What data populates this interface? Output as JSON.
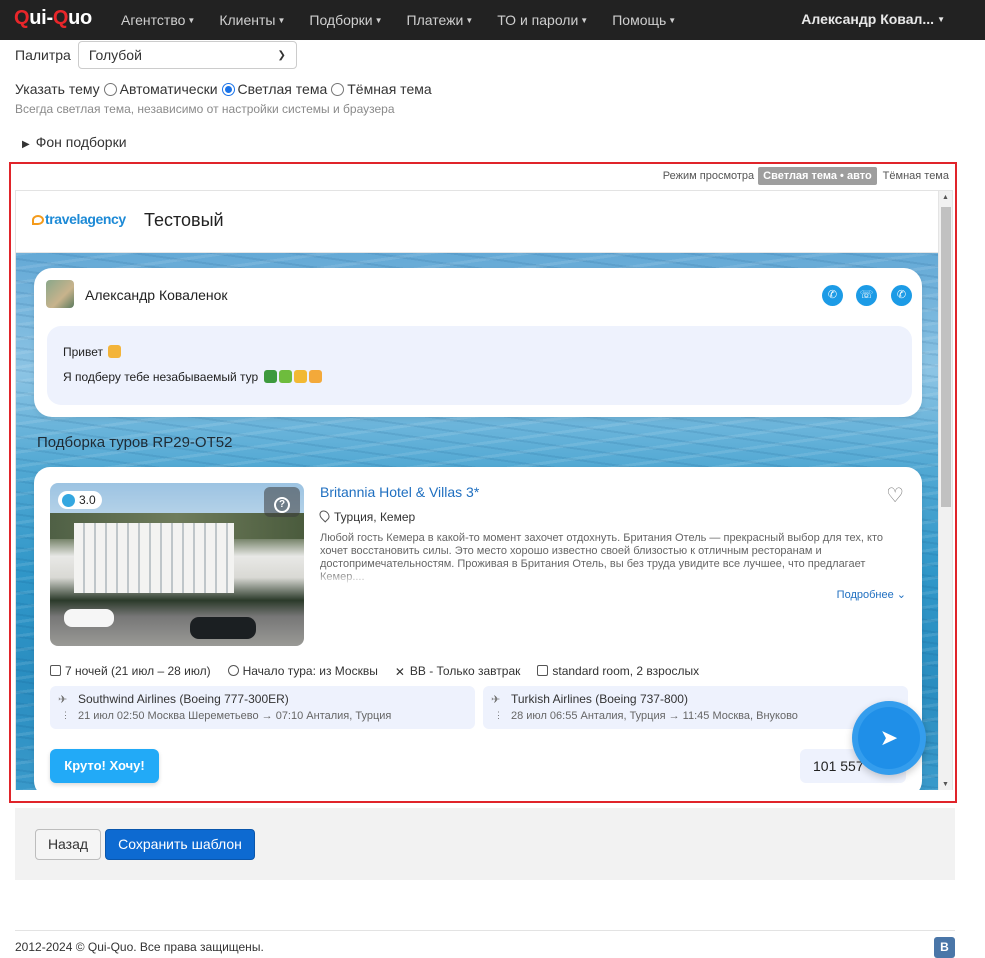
{
  "navbar": {
    "brand_q": "Q",
    "brand_mid": "ui-",
    "brand_q2": "Q",
    "brand_end": "uo",
    "items": [
      {
        "label": "Агентство"
      },
      {
        "label": "Клиенты"
      },
      {
        "label": "Подборки"
      },
      {
        "label": "Платежи"
      },
      {
        "label": "ТО и пароли"
      },
      {
        "label": "Помощь"
      }
    ],
    "user": "Александр Ковал..."
  },
  "settings": {
    "palette_label": "Палитра",
    "palette_value": "Голубой",
    "theme_label": "Указать тему",
    "theme_options": [
      "Автоматически",
      "Светлая тема",
      "Тёмная тема"
    ],
    "theme_selected": "Светлая тема",
    "theme_hint": "Всегда светлая тема, независимо от настройки системы и браузера",
    "background_toggle": "Фон подборки"
  },
  "preview": {
    "mode_label": "Режим просмотра",
    "mode_active": "Светлая тема • авто",
    "mode_other": "Тёмная тема",
    "agency_logo": "travelagency",
    "agency_title": "Тестовый",
    "manager": {
      "name": "Александр Коваленок",
      "greeting": "Привет",
      "message": "Я подберу тебе незабываемый тур"
    },
    "selection_title": "Подборка туров RP29-OT52",
    "hotel": {
      "rating": "3.0",
      "name": "Britannia Hotel & Villas 3*",
      "location": "Турция, Кемер",
      "description": "Любой гость Кемера в какой-то момент захочет отдохнуть. Британия Отель — прекрасный выбор для тех, кто хочет восстановить силы. Это место хорошо известно своей близостью к отличным ресторанам и достопримечательностям. Проживая в Британия Отель, вы без труда увидите все лучшее, что предлагает Кемер....",
      "more": "Подробнее",
      "nights": "7 ночей (21 июл – 28 июл)",
      "start": "Начало тура: из Москвы",
      "meal": "BB - Только завтрак",
      "room": "standard room, 2 взрослых",
      "flight_out": {
        "airline": "Southwind Airlines (Boeing 777-300ER)",
        "route": "21 июл 02:50 Москва Шереметьево → 07:10 Анталия, Турция"
      },
      "flight_back": {
        "airline": "Turkish Airlines (Boeing 737-800)",
        "route": "28 июл 06:55 Анталия, Турция → 11:45 Москва, Внуково"
      },
      "cta": "Круто! Хочу!",
      "price": "101 557"
    }
  },
  "actions": {
    "back": "Назад",
    "save": "Сохранить шаблон"
  },
  "footer": {
    "copyright": "2012-2024 © Qui-Quo. Все права защищены.",
    "vk": "B"
  },
  "colors": {
    "navbar": "#222222",
    "brand_red": "#e8262a",
    "accent": "#0d6ad1",
    "preview_border": "#e0242a",
    "cta": "#22aaf7"
  }
}
